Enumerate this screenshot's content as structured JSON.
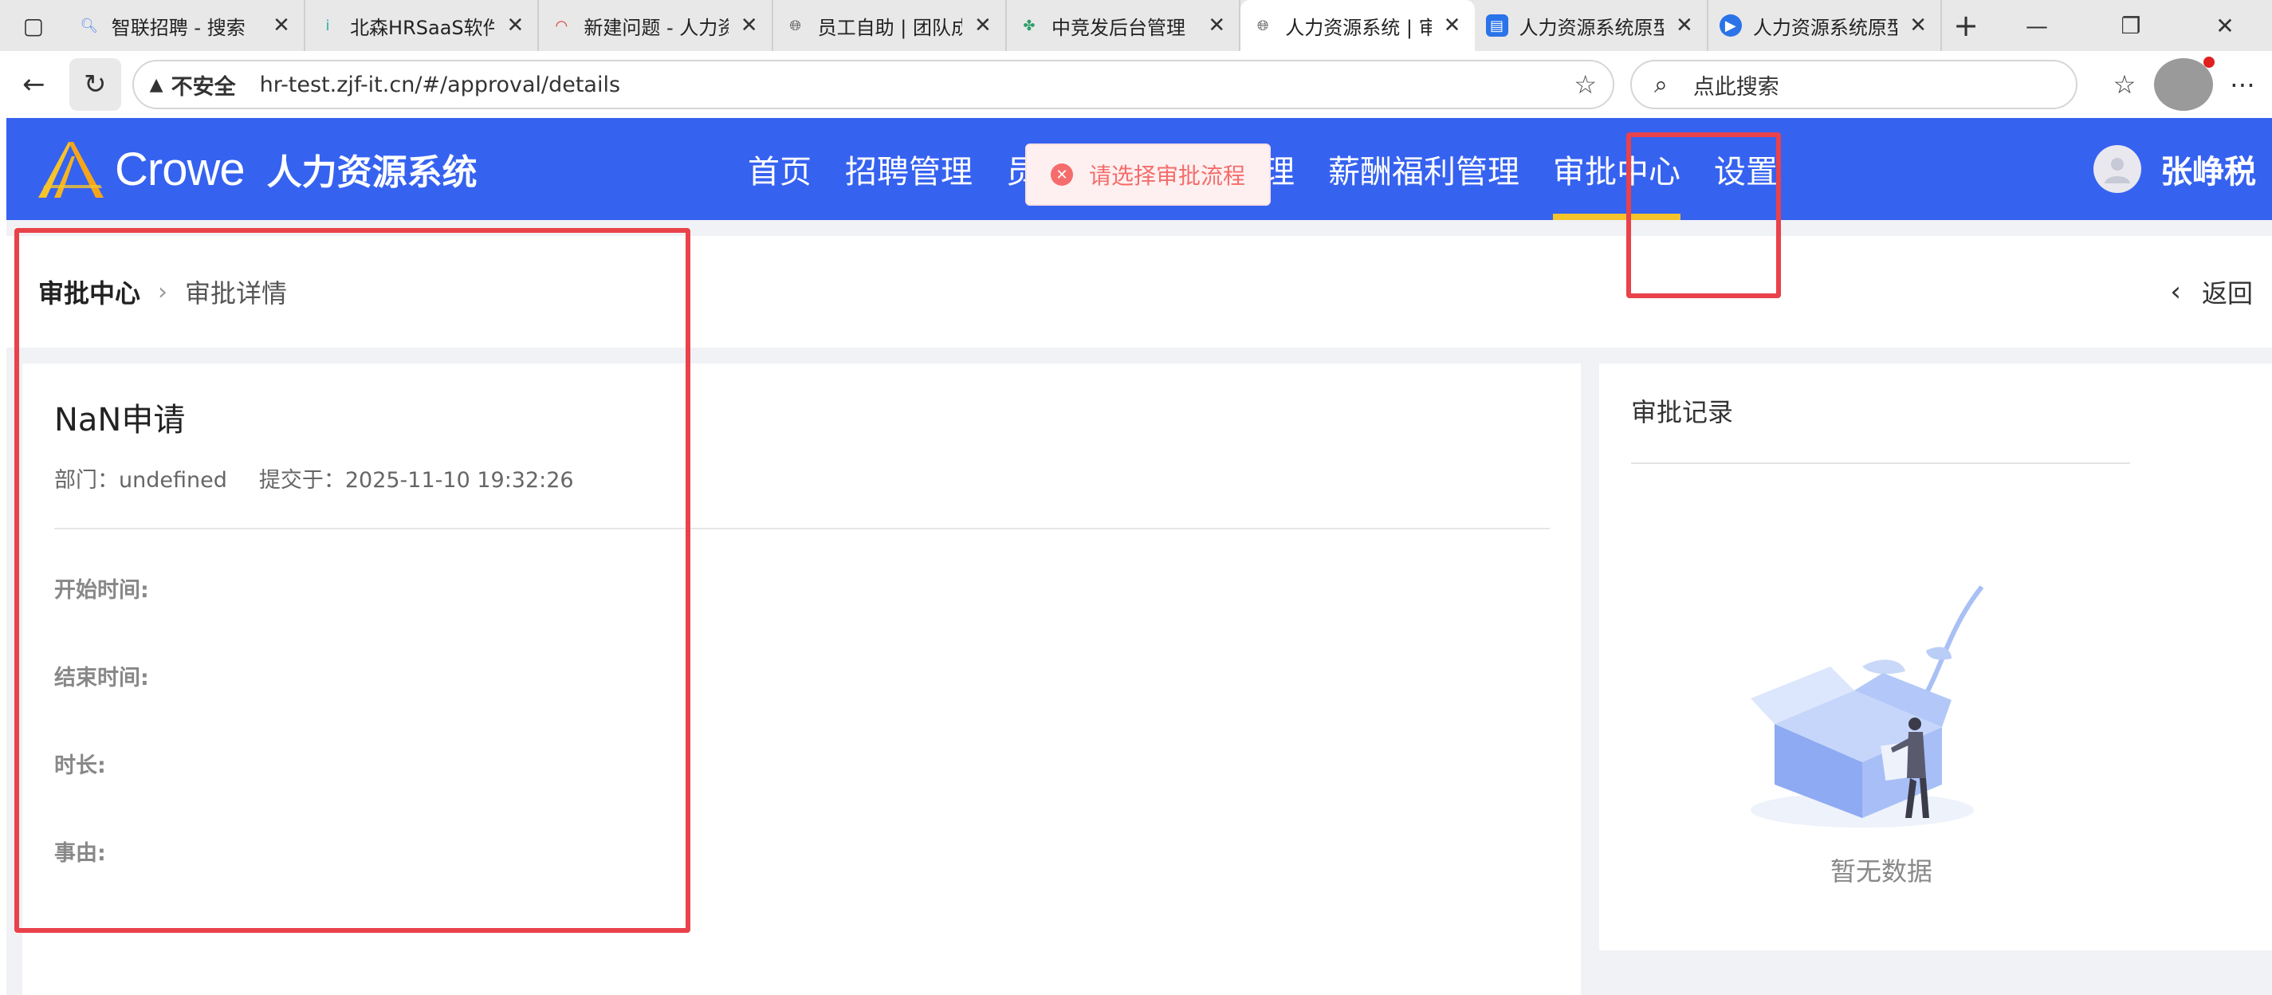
{
  "browser": {
    "tabs": [
      {
        "title": "智联招聘 - 搜索",
        "icon": "search-icon",
        "color": "#5b8def"
      },
      {
        "title": "北森HRSaaS软件",
        "icon": "info-icon",
        "color": "#2bb0a6"
      },
      {
        "title": "新建问题 - 人力资",
        "icon": "gauge-icon",
        "color": "#d0342c"
      },
      {
        "title": "员工自助 | 团队成",
        "icon": "globe-icon",
        "color": "#555555"
      },
      {
        "title": "中竞发后台管理",
        "icon": "leaf-icon",
        "color": "#2e9e6a"
      },
      {
        "title": "人力资源系统 | 审",
        "icon": "globe-icon",
        "color": "#555555"
      },
      {
        "title": "人力资源系统原型",
        "icon": "app-icon",
        "color": "#2a73e8"
      },
      {
        "title": "人力资源系统原型",
        "icon": "play-icon",
        "color": "#2a73e8"
      }
    ],
    "active_tab": 5,
    "security_label": "不安全",
    "url": "hr-test.zjf-it.cn/#/approval/details",
    "search_placeholder": "点此搜索"
  },
  "app": {
    "brand": "Crowe",
    "system_name": "人力资源系统",
    "nav": [
      "首页",
      "招聘管理",
      "员工管理",
      "考勤管理",
      "薪酬福利管理",
      "审批中心",
      "设置"
    ],
    "active_nav": "审批中心",
    "user_name": "张峥税",
    "accent": "#3662f0",
    "active_indicator": "#f5c32c"
  },
  "toast": {
    "message": "请选择审批流程",
    "type": "error"
  },
  "breadcrumb": {
    "root": "审批中心",
    "current": "审批详情",
    "back_label": "返回"
  },
  "detail": {
    "title": "NaN申请",
    "department_label": "部门：",
    "department_value": "undefined",
    "submitted_label": "提交于：",
    "submitted_value": "2025-11-10 19:32:26",
    "fields": {
      "start": "开始时间:",
      "end": "结束时间:",
      "duration": "时长:",
      "reason": "事由:"
    }
  },
  "records": {
    "title": "审批记录",
    "empty_text": "暂无数据"
  },
  "annotations": {
    "color": "#e9424a"
  }
}
